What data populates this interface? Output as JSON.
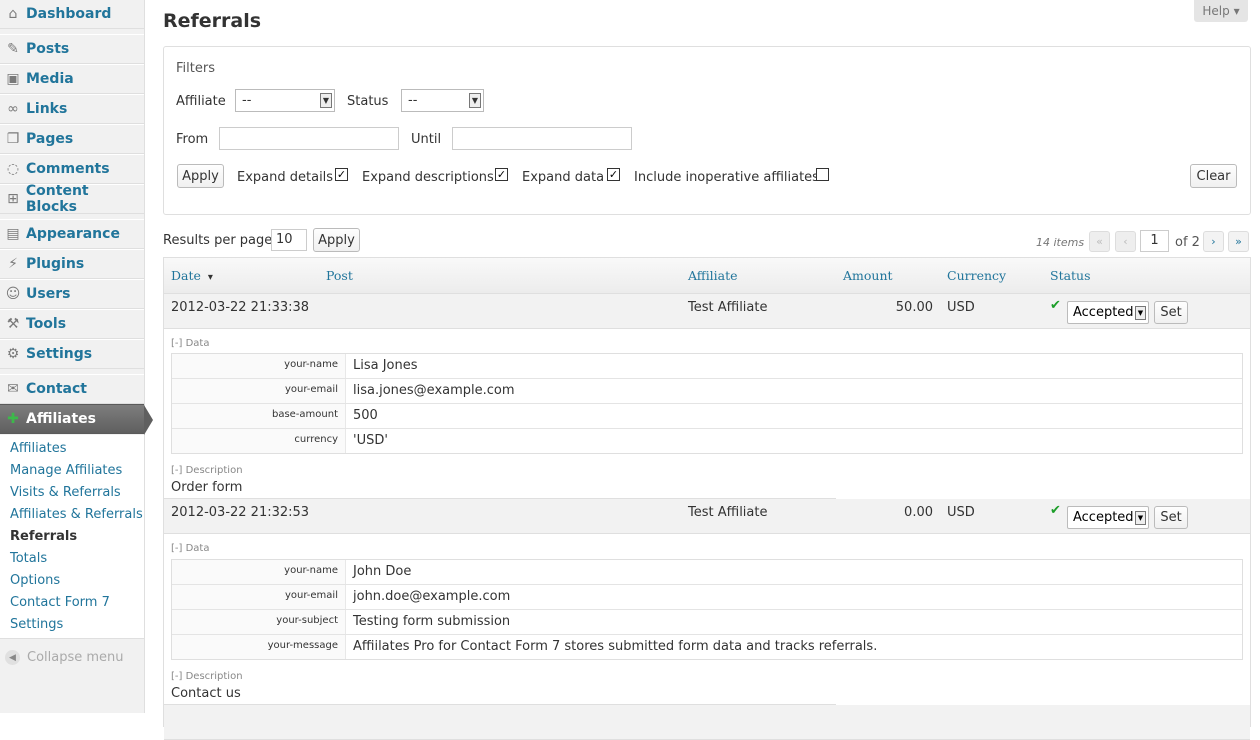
{
  "sidebar": {
    "menu": [
      {
        "label": "Dashboard",
        "icon": "dashboard-icon",
        "glyph": "⌂"
      },
      {
        "label": "Posts",
        "icon": "pushpin-icon",
        "glyph": "✎"
      },
      {
        "label": "Media",
        "icon": "media-icon",
        "glyph": "▣"
      },
      {
        "label": "Links",
        "icon": "links-icon",
        "glyph": "∞"
      },
      {
        "label": "Pages",
        "icon": "pages-icon",
        "glyph": "❐"
      },
      {
        "label": "Comments",
        "icon": "comments-icon",
        "glyph": "◌"
      },
      {
        "label": "Content Blocks",
        "icon": "content-blocks-icon",
        "glyph": "⊞"
      },
      {
        "label": "Appearance",
        "icon": "appearance-icon",
        "glyph": "▤"
      },
      {
        "label": "Plugins",
        "icon": "plugins-icon",
        "glyph": "⚡"
      },
      {
        "label": "Users",
        "icon": "users-icon",
        "glyph": "☺"
      },
      {
        "label": "Tools",
        "icon": "tools-icon",
        "glyph": "⚒"
      },
      {
        "label": "Settings",
        "icon": "settings-icon",
        "glyph": "⚙"
      },
      {
        "label": "Contact",
        "icon": "contact-icon",
        "glyph": "✉"
      },
      {
        "label": "Affiliates",
        "icon": "affiliates-icon",
        "glyph": "✚"
      }
    ],
    "submenu": [
      {
        "label": "Affiliates"
      },
      {
        "label": "Manage Affiliates"
      },
      {
        "label": "Visits & Referrals"
      },
      {
        "label": "Affiliates & Referrals"
      },
      {
        "label": "Referrals"
      },
      {
        "label": "Totals"
      },
      {
        "label": "Options"
      },
      {
        "label": "Contact Form 7"
      },
      {
        "label": "Settings"
      }
    ],
    "collapse_label": "Collapse menu"
  },
  "header": {
    "title": "Referrals",
    "help_label": "Help ▾"
  },
  "filters": {
    "legend": "Filters",
    "affiliate_label": "Affiliate",
    "affiliate_value": "--",
    "status_label": "Status",
    "status_value": "--",
    "from_label": "From",
    "from_value": "",
    "until_label": "Until",
    "until_value": "",
    "apply_label": "Apply",
    "clear_label": "Clear",
    "checkboxes": [
      {
        "label": "Expand details",
        "checked": true
      },
      {
        "label": "Expand descriptions",
        "checked": true
      },
      {
        "label": "Expand data",
        "checked": true
      },
      {
        "label": "Include inoperative affiliates",
        "checked": false
      }
    ]
  },
  "results": {
    "per_page_label": "Results per page",
    "per_page_value": "10",
    "apply_label": "Apply",
    "items_count": "14 items",
    "current_page": "1",
    "of_pages": "of 2",
    "first_glyph": "«",
    "prev_glyph": "‹",
    "next_glyph": "›",
    "last_glyph": "»"
  },
  "table": {
    "columns": [
      "Date",
      "Post",
      "Affiliate",
      "Amount",
      "Currency",
      "Status"
    ],
    "sort_indicator": "▾",
    "data_label": "[-] Data",
    "description_label": "[-] Description",
    "set_label": "Set",
    "rows": [
      {
        "date": "2012-03-22 21:33:38",
        "post": "",
        "affiliate": "Test Affiliate",
        "amount": "50.00",
        "currency": "USD",
        "status": "Accepted",
        "data": [
          {
            "key": "your-name",
            "value": "Lisa Jones"
          },
          {
            "key": "your-email",
            "value": "lisa.jones@example.com"
          },
          {
            "key": "base-amount",
            "value": "500"
          },
          {
            "key": "currency",
            "value": "'USD'"
          }
        ],
        "description": "Order form"
      },
      {
        "date": "2012-03-22 21:32:53",
        "post": "",
        "affiliate": "Test Affiliate",
        "amount": "0.00",
        "currency": "USD",
        "status": "Accepted",
        "data": [
          {
            "key": "your-name",
            "value": "John Doe"
          },
          {
            "key": "your-email",
            "value": "john.doe@example.com"
          },
          {
            "key": "your-subject",
            "value": "Testing form submission"
          },
          {
            "key": "your-message",
            "value": "Affiilates Pro for Contact Form 7 stores submitted form data and tracks referrals."
          }
        ],
        "description": "Contact us"
      }
    ]
  },
  "colors": {
    "link": "#21759b",
    "active_menu": "#6e6e6e",
    "accepted_check": "#1c9e29"
  }
}
